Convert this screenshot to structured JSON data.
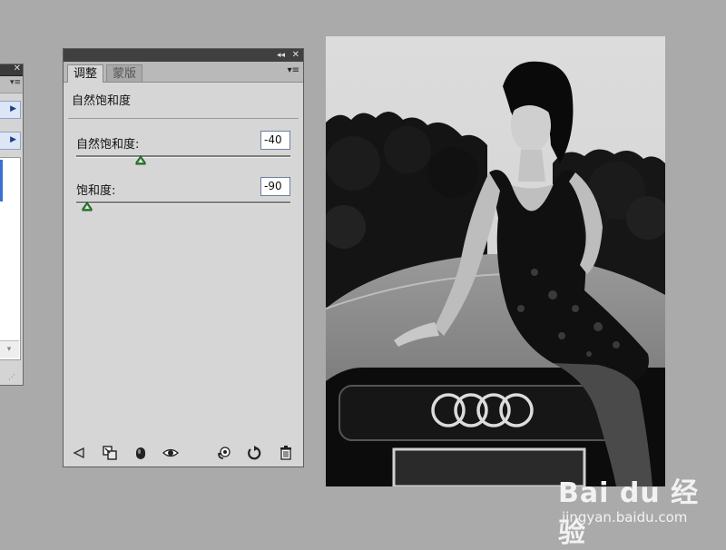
{
  "adjustments_panel": {
    "tabs": [
      {
        "label": "调整",
        "active": true
      },
      {
        "label": "蒙版",
        "active": false
      }
    ],
    "section_title": "自然饱和度",
    "sliders": [
      {
        "label": "自然饱和度:",
        "value": "-40",
        "level_fraction": 0.3
      },
      {
        "label": "饱和度:",
        "value": "-90",
        "level_fraction": 0.05
      }
    ],
    "toolbar_icons": [
      "back-arrow-icon",
      "expand-view-icon",
      "clip-layer-icon",
      "visibility-eye-icon",
      "previous-state-icon",
      "reset-icon",
      "trash-icon"
    ],
    "titlebar_icons": [
      "collapse-double-arrow-icon",
      "close-icon"
    ]
  },
  "left_panel": {
    "icons": [
      "close-icon",
      "panel-menu-icon",
      "expand-arrow-icon",
      "expand-arrow-icon",
      "scroll-down-icon",
      "resize-grip-icon"
    ]
  },
  "photo": {
    "description_icon": "grayscale-portrait-photo",
    "car_badge": "audi-rings-icon"
  },
  "watermark": {
    "brand": "Bai du 经验",
    "url": "jingyan.baidu.com"
  },
  "colors": {
    "background": "#aaaaaa",
    "panel": "#d6d6d6",
    "titlebar": "#404040",
    "slider_thumb": "#3c8c3c"
  }
}
